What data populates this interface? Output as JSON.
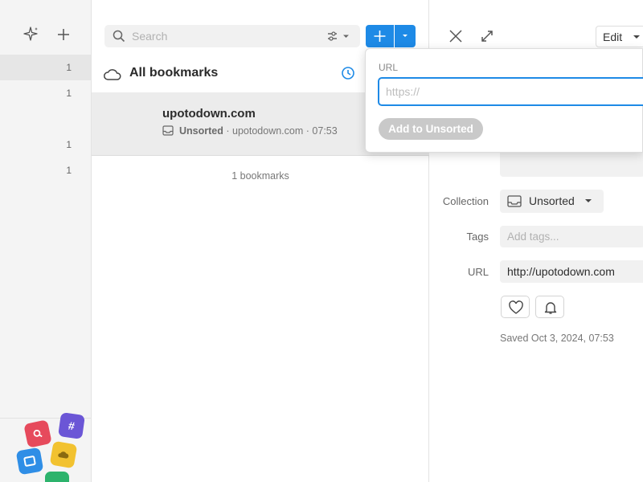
{
  "sidebar": {
    "counts": [
      "1",
      "1",
      "1",
      "1"
    ]
  },
  "middle": {
    "search_placeholder": "Search",
    "list_title": "All bookmarks",
    "item": {
      "title": "upotodown.com",
      "collection": "Unsorted",
      "domain": "upotodown.com",
      "time": "07:53",
      "separator": "·"
    },
    "count_label": "1 bookmarks"
  },
  "popover": {
    "url_label": "URL",
    "url_placeholder": "https://",
    "add_button": "Add to Unsorted"
  },
  "right": {
    "edit_label": "Edit",
    "collection_label": "Collection",
    "collection_value": "Unsorted",
    "tags_label": "Tags",
    "tags_placeholder": "Add tags...",
    "url_label": "URL",
    "url_value": "http://upotodown.com",
    "saved_text": "Saved Oct 3, 2024, 07:53"
  },
  "colors": {
    "accent": "#1e8ae6",
    "sidebar_bg": "#f4f4f4",
    "selected_item_bg": "#ececec",
    "disabled_button": "#c9c9c9"
  }
}
